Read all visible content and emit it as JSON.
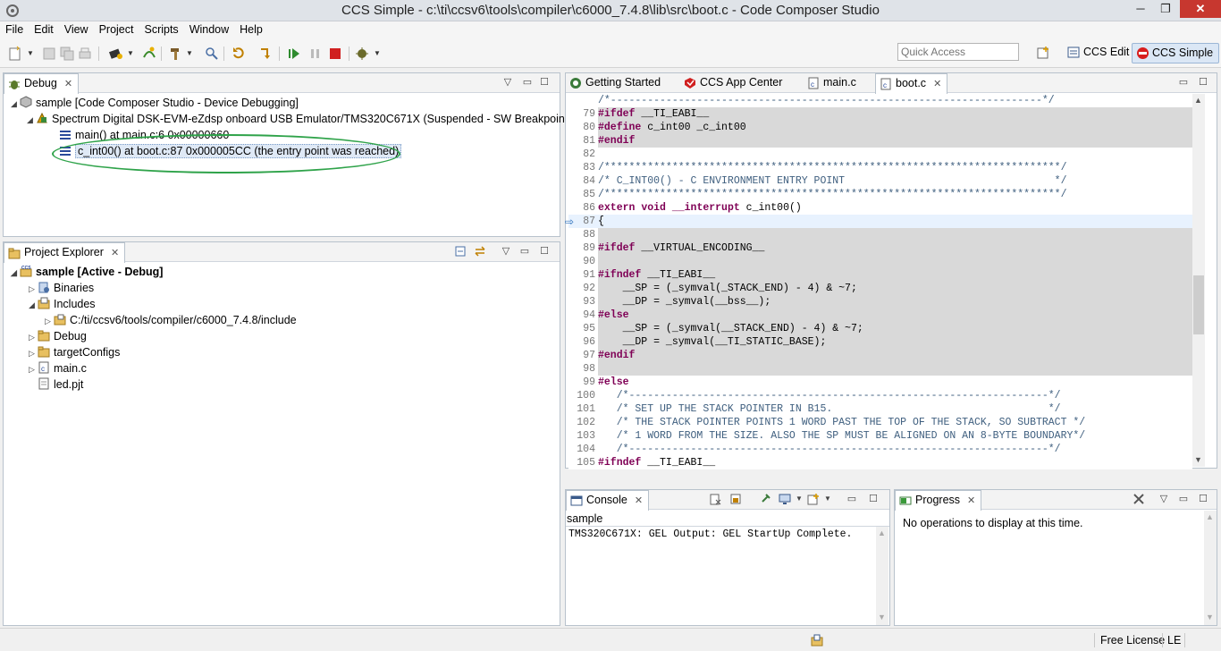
{
  "window": {
    "title": "CCS Simple - c:\\ti\\ccsv6\\tools\\compiler\\c6000_7.4.8\\lib\\src\\boot.c - Code Composer Studio",
    "minimize": "─",
    "maximize": "❐",
    "close": "✕"
  },
  "menu": [
    "File",
    "Edit",
    "View",
    "Project",
    "Scripts",
    "Window",
    "Help"
  ],
  "toolbar": {
    "quick_access_placeholder": "Quick Access",
    "perspectives": [
      {
        "label": "CCS Edit",
        "active": false
      },
      {
        "label": "CCS Simple",
        "active": true
      }
    ]
  },
  "debug_view": {
    "tab": "Debug",
    "close": "✕",
    "tree": [
      {
        "label": "sample [Code Composer Studio - Device Debugging]",
        "icon": "debug-session-icon"
      },
      {
        "label": "Spectrum Digital DSK-EVM-eZdsp onboard USB Emulator/TMS320C671X (Suspended - SW Breakpoint)",
        "icon": "thread-icon"
      },
      {
        "label": "main() at main.c:6 0x00000660",
        "icon": "stack-frame-icon"
      },
      {
        "label": "c_int00() at boot.c:87 0x000005CC  (the entry point was reached)",
        "icon": "stack-frame-icon",
        "selected": true
      }
    ]
  },
  "project_explorer": {
    "tab": "Project Explorer",
    "close": "✕",
    "tree": [
      {
        "label": "sample  [Active - Debug]",
        "bold": true,
        "icon": "ccs-project-icon"
      },
      {
        "label": "Binaries",
        "icon": "binaries-icon"
      },
      {
        "label": "Includes",
        "icon": "includes-icon"
      },
      {
        "label": "C:/ti/ccsv6/tools/compiler/c6000_7.4.8/include",
        "icon": "include-folder-icon"
      },
      {
        "label": "Debug",
        "icon": "folder-icon"
      },
      {
        "label": "targetConfigs",
        "icon": "folder-icon"
      },
      {
        "label": "main.c",
        "icon": "c-file-icon"
      },
      {
        "label": "led.pjt",
        "icon": "file-icon"
      }
    ]
  },
  "editor": {
    "tabs": [
      {
        "label": "Getting Started",
        "icon": "getting-started-icon"
      },
      {
        "label": "CCS App Center",
        "icon": "app-center-icon"
      },
      {
        "label": "main.c",
        "icon": "c-file-icon"
      },
      {
        "label": "boot.c",
        "icon": "c-file-icon",
        "active": true,
        "close": "✕"
      }
    ],
    "lines": [
      {
        "n": "",
        "text": "/*----------------------------------------------------------------------*/",
        "gray": false,
        "type": "comment"
      },
      {
        "n": "79",
        "text": "#ifdef __TI_EABI__",
        "gray": true,
        "type": "directive"
      },
      {
        "n": "80",
        "text": "#define c_int00 _c_int00",
        "gray": true,
        "type": "directive"
      },
      {
        "n": "81",
        "text": "#endif",
        "gray": true,
        "type": "directive"
      },
      {
        "n": "82",
        "text": "",
        "gray": false,
        "type": "plain"
      },
      {
        "n": "83",
        "text": "/**************************************************************************/",
        "gray": false,
        "type": "comment"
      },
      {
        "n": "84",
        "text": "/* C_INT00() - C ENVIRONMENT ENTRY POINT                                  */",
        "gray": false,
        "type": "comment"
      },
      {
        "n": "85",
        "text": "/**************************************************************************/",
        "gray": false,
        "type": "comment"
      },
      {
        "n": "86",
        "text": "extern void __interrupt c_int00()",
        "gray": false,
        "type": "decl"
      },
      {
        "n": "87",
        "text": "{",
        "gray": false,
        "type": "plain",
        "current": true
      },
      {
        "n": "88",
        "text": "",
        "gray": true,
        "type": "plain"
      },
      {
        "n": "89",
        "text": "#ifdef __VIRTUAL_ENCODING__",
        "gray": true,
        "type": "directive"
      },
      {
        "n": "90",
        "text": "",
        "gray": true,
        "type": "plain"
      },
      {
        "n": "91",
        "text": "#ifndef __TI_EABI__",
        "gray": true,
        "type": "directive"
      },
      {
        "n": "92",
        "text": "    __SP = (_symval(_STACK_END) - 4) & ~7;",
        "gray": true,
        "type": "plain"
      },
      {
        "n": "93",
        "text": "    __DP = _symval(__bss__);",
        "gray": true,
        "type": "plain"
      },
      {
        "n": "94",
        "text": "#else",
        "gray": true,
        "type": "directive"
      },
      {
        "n": "95",
        "text": "    __SP = (_symval(__STACK_END) - 4) & ~7;",
        "gray": true,
        "type": "plain"
      },
      {
        "n": "96",
        "text": "    __DP = _symval(__TI_STATIC_BASE);",
        "gray": true,
        "type": "plain"
      },
      {
        "n": "97",
        "text": "#endif",
        "gray": true,
        "type": "directive"
      },
      {
        "n": "98",
        "text": "",
        "gray": true,
        "type": "plain"
      },
      {
        "n": "99",
        "text": "#else",
        "gray": false,
        "type": "directive"
      },
      {
        "n": "100",
        "text": "   /*--------------------------------------------------------------------*/",
        "gray": false,
        "type": "comment"
      },
      {
        "n": "101",
        "text": "   /* SET UP THE STACK POINTER IN B15.                                   */",
        "gray": false,
        "type": "comment"
      },
      {
        "n": "102",
        "text": "   /* THE STACK POINTER POINTS 1 WORD PAST THE TOP OF THE STACK, SO SUBTRACT */",
        "gray": false,
        "type": "comment"
      },
      {
        "n": "103",
        "text": "   /* 1 WORD FROM THE SIZE. ALSO THE SP MUST BE ALIGNED ON AN 8-BYTE BOUNDARY*/",
        "gray": false,
        "type": "comment"
      },
      {
        "n": "104",
        "text": "   /*--------------------------------------------------------------------*/",
        "gray": false,
        "type": "comment"
      },
      {
        "n": "105",
        "text": "#ifndef __TI_EABI__",
        "gray": false,
        "type": "directive"
      }
    ]
  },
  "console_view": {
    "tab": "Console",
    "close": "✕",
    "context": "sample",
    "output": "TMS320C671X: GEL Output: GEL StartUp Complete."
  },
  "progress_view": {
    "tab": "Progress",
    "close": "✕",
    "message": "No operations to display at this time."
  },
  "status": {
    "license": "Free License",
    "le": "LE"
  }
}
